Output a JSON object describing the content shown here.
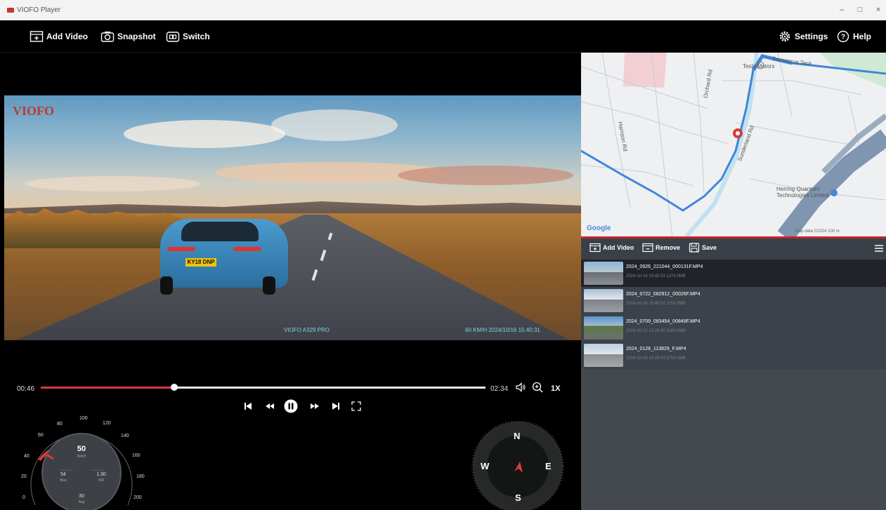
{
  "window": {
    "title": "VIOFO Player",
    "minimize": "–",
    "maximize": "□",
    "close": "×"
  },
  "toolbar": {
    "add_video": "Add Video",
    "snapshot": "Snapshot",
    "switch": "Switch",
    "settings": "Settings",
    "help": "Help"
  },
  "video": {
    "watermark": "VIOFO",
    "plate": "KY18 DNP",
    "model_overlay": "VIOFO A329 PRO",
    "info_overlay": "60 KM/H 2024/10/16 15:40:31"
  },
  "map": {
    "labels": [
      "Tesla Motors",
      "Damascus Tech",
      "Harrison Rd",
      "Orchard Rd",
      "Sunderland Rd",
      "Herring Quantum Technologies Limited"
    ],
    "logo": "Google",
    "scale": "Map data ©2024  100 m"
  },
  "playlist": {
    "add_video": "Add Video",
    "remove": "Remove",
    "save": "Save",
    "items": [
      {
        "name": "2024_0926_221044_000131F.MP4",
        "meta": "2024-10-16 15:40:33    1274.0MB"
      },
      {
        "name": "2024_0722_082912_00026F.MP4",
        "meta": "2024-10-16 15:40:52    1183.0MB"
      },
      {
        "name": "2024_0709_083454_00849F.MP4",
        "meta": "2024-10-10 13:28:30    1183.0MB"
      },
      {
        "name": "2024_0128_113829_F.MP4",
        "meta": "2024-10-16 13:28:03    2753.0MB"
      }
    ]
  },
  "controls": {
    "current_time": "00:46",
    "total_time": "02:34",
    "progress": 0.3,
    "speed": "1X"
  },
  "speedometer": {
    "ticks": [
      "0",
      "20",
      "40",
      "60",
      "80",
      "100",
      "120",
      "140",
      "160",
      "180",
      "200"
    ],
    "speed": "50",
    "speed_unit": "KM/H",
    "max": "54",
    "max_label": "Max",
    "distance": "1.30",
    "distance_unit": "KM",
    "avg": "30",
    "avg_label": "Avg"
  },
  "compass": {
    "n": "N",
    "s": "S",
    "e": "E",
    "w": "W"
  },
  "colors": {
    "accent": "#d93a3a",
    "panel": "#3b424a",
    "background": "#000000"
  }
}
